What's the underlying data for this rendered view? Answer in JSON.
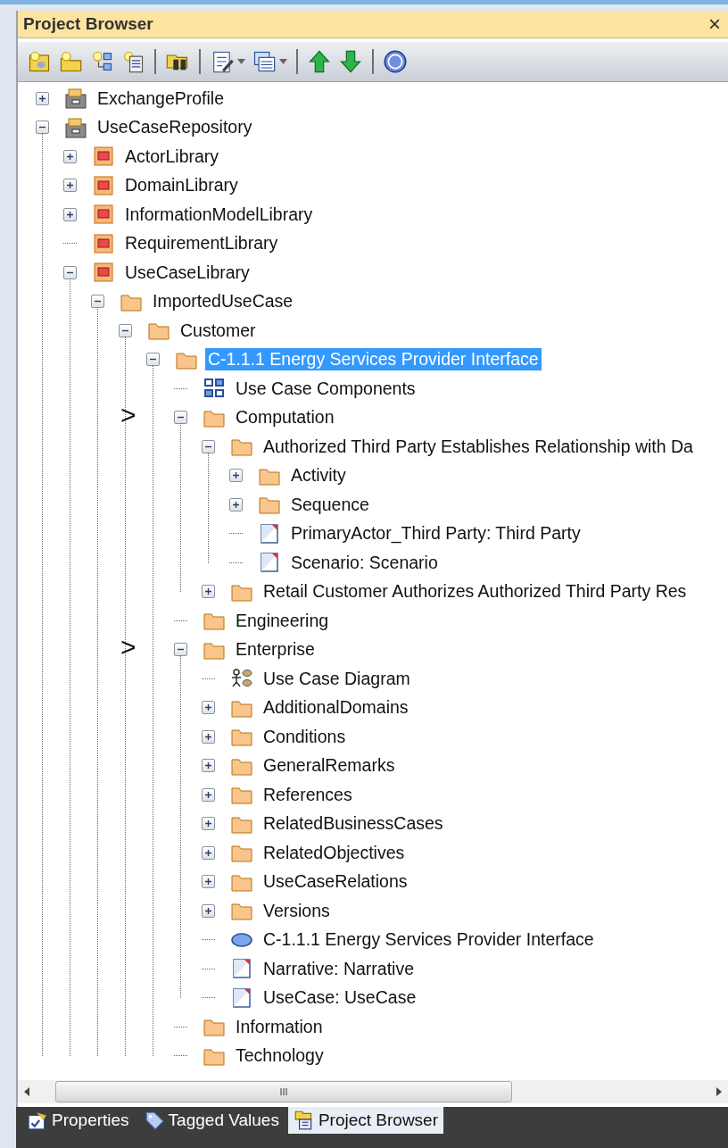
{
  "panel": {
    "title": "Project Browser",
    "close": "×"
  },
  "toolbar": [
    {
      "kind": "new-model"
    },
    {
      "kind": "new-folder"
    },
    {
      "kind": "new-view"
    },
    {
      "kind": "new-element"
    },
    {
      "kind": "sep"
    },
    {
      "kind": "find"
    },
    {
      "kind": "sep"
    },
    {
      "kind": "edit",
      "dropdown": true
    },
    {
      "kind": "windows",
      "dropdown": true
    },
    {
      "kind": "sep"
    },
    {
      "kind": "up"
    },
    {
      "kind": "down"
    },
    {
      "kind": "sep"
    },
    {
      "kind": "help"
    }
  ],
  "tree": [
    {
      "label": "ExchangeProfile",
      "kind": "repository",
      "expanded": false,
      "selected": false
    },
    {
      "label": "UseCaseRepository",
      "kind": "repository",
      "expanded": true,
      "selected": false,
      "children": [
        {
          "label": "ActorLibrary",
          "kind": "library",
          "expanded": false,
          "selected": false
        },
        {
          "label": "DomainLibrary",
          "kind": "library",
          "expanded": false,
          "selected": false
        },
        {
          "label": "InformationModelLibrary",
          "kind": "library",
          "expanded": false,
          "selected": false
        },
        {
          "label": "RequirementLibrary",
          "kind": "library",
          "selected": false
        },
        {
          "label": "UseCaseLibrary",
          "kind": "library",
          "expanded": true,
          "selected": false,
          "children": [
            {
              "label": "ImportedUseCase",
              "kind": "folder",
              "expanded": true,
              "selected": false,
              "children": [
                {
                  "label": "Customer",
                  "kind": "folder",
                  "expanded": true,
                  "selected": false,
                  "children": [
                    {
                      "label": "C-1.1.1 Energy Services Provider Interface",
                      "kind": "folder",
                      "expanded": true,
                      "selected": true,
                      "children": [
                        {
                          "label": "Use Case Components",
                          "kind": "components",
                          "selected": false
                        },
                        {
                          "label": "Computation",
                          "kind": "folder",
                          "expanded": true,
                          "selected": false,
                          "marker": ">",
                          "children": [
                            {
                              "label": "Authorized Third Party Establishes Relationship with Da",
                              "kind": "folder",
                              "expanded": true,
                              "selected": false,
                              "children": [
                                {
                                  "label": "Activity",
                                  "kind": "folder",
                                  "expanded": false,
                                  "selected": false
                                },
                                {
                                  "label": "Sequence",
                                  "kind": "folder",
                                  "expanded": false,
                                  "selected": false
                                },
                                {
                                  "label": "PrimaryActor_Third Party: Third Party",
                                  "kind": "document",
                                  "selected": false
                                },
                                {
                                  "label": "Scenario: Scenario",
                                  "kind": "document",
                                  "selected": false
                                }
                              ]
                            },
                            {
                              "label": "Retail Customer Authorizes Authorized Third Party Res",
                              "kind": "folder",
                              "expanded": false,
                              "selected": false
                            }
                          ]
                        },
                        {
                          "label": "Engineering",
                          "kind": "folder",
                          "selected": false
                        },
                        {
                          "label": "Enterprise",
                          "kind": "folder",
                          "expanded": true,
                          "selected": false,
                          "marker": ">",
                          "children": [
                            {
                              "label": "Use Case Diagram",
                              "kind": "diagram",
                              "selected": false
                            },
                            {
                              "label": "AdditionalDomains",
                              "kind": "folder",
                              "expanded": false,
                              "selected": false
                            },
                            {
                              "label": "Conditions",
                              "kind": "folder",
                              "expanded": false,
                              "selected": false
                            },
                            {
                              "label": "GeneralRemarks",
                              "kind": "folder",
                              "expanded": false,
                              "selected": false
                            },
                            {
                              "label": "References",
                              "kind": "folder",
                              "expanded": false,
                              "selected": false
                            },
                            {
                              "label": "RelatedBusinessCases",
                              "kind": "folder",
                              "expanded": false,
                              "selected": false
                            },
                            {
                              "label": "RelatedObjectives",
                              "kind": "folder",
                              "expanded": false,
                              "selected": false
                            },
                            {
                              "label": "UseCaseRelations",
                              "kind": "folder",
                              "expanded": false,
                              "selected": false
                            },
                            {
                              "label": "Versions",
                              "kind": "folder",
                              "expanded": false,
                              "selected": false
                            },
                            {
                              "label": "C-1.1.1 Energy Services Provider Interface",
                              "kind": "usecase",
                              "selected": false
                            },
                            {
                              "label": "Narrative: Narrative",
                              "kind": "document",
                              "selected": false
                            },
                            {
                              "label": "UseCase: UseCase",
                              "kind": "document",
                              "selected": false
                            }
                          ]
                        },
                        {
                          "label": "Information",
                          "kind": "folder",
                          "selected": false
                        },
                        {
                          "label": "Technology",
                          "kind": "folder",
                          "selected": false
                        }
                      ]
                    }
                  ]
                }
              ]
            }
          ]
        }
      ]
    }
  ],
  "scrollbar": {
    "grip": "III"
  },
  "tabs": [
    {
      "label": "Properties",
      "kind": "properties",
      "selected": false
    },
    {
      "label": "Tagged Values",
      "kind": "tags",
      "selected": false
    },
    {
      "label": "Project Browser",
      "kind": "browser",
      "selected": true
    }
  ]
}
